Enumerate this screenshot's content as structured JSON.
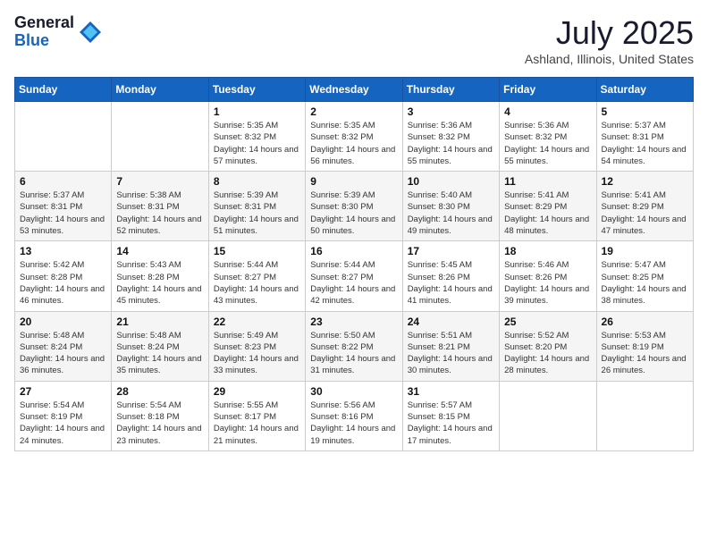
{
  "logo": {
    "general": "General",
    "blue": "Blue"
  },
  "header": {
    "month": "July 2025",
    "location": "Ashland, Illinois, United States"
  },
  "days_of_week": [
    "Sunday",
    "Monday",
    "Tuesday",
    "Wednesday",
    "Thursday",
    "Friday",
    "Saturday"
  ],
  "weeks": [
    [
      {
        "day": "",
        "sunrise": "",
        "sunset": "",
        "daylight": ""
      },
      {
        "day": "",
        "sunrise": "",
        "sunset": "",
        "daylight": ""
      },
      {
        "day": "1",
        "sunrise": "Sunrise: 5:35 AM",
        "sunset": "Sunset: 8:32 PM",
        "daylight": "Daylight: 14 hours and 57 minutes."
      },
      {
        "day": "2",
        "sunrise": "Sunrise: 5:35 AM",
        "sunset": "Sunset: 8:32 PM",
        "daylight": "Daylight: 14 hours and 56 minutes."
      },
      {
        "day": "3",
        "sunrise": "Sunrise: 5:36 AM",
        "sunset": "Sunset: 8:32 PM",
        "daylight": "Daylight: 14 hours and 55 minutes."
      },
      {
        "day": "4",
        "sunrise": "Sunrise: 5:36 AM",
        "sunset": "Sunset: 8:32 PM",
        "daylight": "Daylight: 14 hours and 55 minutes."
      },
      {
        "day": "5",
        "sunrise": "Sunrise: 5:37 AM",
        "sunset": "Sunset: 8:31 PM",
        "daylight": "Daylight: 14 hours and 54 minutes."
      }
    ],
    [
      {
        "day": "6",
        "sunrise": "Sunrise: 5:37 AM",
        "sunset": "Sunset: 8:31 PM",
        "daylight": "Daylight: 14 hours and 53 minutes."
      },
      {
        "day": "7",
        "sunrise": "Sunrise: 5:38 AM",
        "sunset": "Sunset: 8:31 PM",
        "daylight": "Daylight: 14 hours and 52 minutes."
      },
      {
        "day": "8",
        "sunrise": "Sunrise: 5:39 AM",
        "sunset": "Sunset: 8:31 PM",
        "daylight": "Daylight: 14 hours and 51 minutes."
      },
      {
        "day": "9",
        "sunrise": "Sunrise: 5:39 AM",
        "sunset": "Sunset: 8:30 PM",
        "daylight": "Daylight: 14 hours and 50 minutes."
      },
      {
        "day": "10",
        "sunrise": "Sunrise: 5:40 AM",
        "sunset": "Sunset: 8:30 PM",
        "daylight": "Daylight: 14 hours and 49 minutes."
      },
      {
        "day": "11",
        "sunrise": "Sunrise: 5:41 AM",
        "sunset": "Sunset: 8:29 PM",
        "daylight": "Daylight: 14 hours and 48 minutes."
      },
      {
        "day": "12",
        "sunrise": "Sunrise: 5:41 AM",
        "sunset": "Sunset: 8:29 PM",
        "daylight": "Daylight: 14 hours and 47 minutes."
      }
    ],
    [
      {
        "day": "13",
        "sunrise": "Sunrise: 5:42 AM",
        "sunset": "Sunset: 8:28 PM",
        "daylight": "Daylight: 14 hours and 46 minutes."
      },
      {
        "day": "14",
        "sunrise": "Sunrise: 5:43 AM",
        "sunset": "Sunset: 8:28 PM",
        "daylight": "Daylight: 14 hours and 45 minutes."
      },
      {
        "day": "15",
        "sunrise": "Sunrise: 5:44 AM",
        "sunset": "Sunset: 8:27 PM",
        "daylight": "Daylight: 14 hours and 43 minutes."
      },
      {
        "day": "16",
        "sunrise": "Sunrise: 5:44 AM",
        "sunset": "Sunset: 8:27 PM",
        "daylight": "Daylight: 14 hours and 42 minutes."
      },
      {
        "day": "17",
        "sunrise": "Sunrise: 5:45 AM",
        "sunset": "Sunset: 8:26 PM",
        "daylight": "Daylight: 14 hours and 41 minutes."
      },
      {
        "day": "18",
        "sunrise": "Sunrise: 5:46 AM",
        "sunset": "Sunset: 8:26 PM",
        "daylight": "Daylight: 14 hours and 39 minutes."
      },
      {
        "day": "19",
        "sunrise": "Sunrise: 5:47 AM",
        "sunset": "Sunset: 8:25 PM",
        "daylight": "Daylight: 14 hours and 38 minutes."
      }
    ],
    [
      {
        "day": "20",
        "sunrise": "Sunrise: 5:48 AM",
        "sunset": "Sunset: 8:24 PM",
        "daylight": "Daylight: 14 hours and 36 minutes."
      },
      {
        "day": "21",
        "sunrise": "Sunrise: 5:48 AM",
        "sunset": "Sunset: 8:24 PM",
        "daylight": "Daylight: 14 hours and 35 minutes."
      },
      {
        "day": "22",
        "sunrise": "Sunrise: 5:49 AM",
        "sunset": "Sunset: 8:23 PM",
        "daylight": "Daylight: 14 hours and 33 minutes."
      },
      {
        "day": "23",
        "sunrise": "Sunrise: 5:50 AM",
        "sunset": "Sunset: 8:22 PM",
        "daylight": "Daylight: 14 hours and 31 minutes."
      },
      {
        "day": "24",
        "sunrise": "Sunrise: 5:51 AM",
        "sunset": "Sunset: 8:21 PM",
        "daylight": "Daylight: 14 hours and 30 minutes."
      },
      {
        "day": "25",
        "sunrise": "Sunrise: 5:52 AM",
        "sunset": "Sunset: 8:20 PM",
        "daylight": "Daylight: 14 hours and 28 minutes."
      },
      {
        "day": "26",
        "sunrise": "Sunrise: 5:53 AM",
        "sunset": "Sunset: 8:19 PM",
        "daylight": "Daylight: 14 hours and 26 minutes."
      }
    ],
    [
      {
        "day": "27",
        "sunrise": "Sunrise: 5:54 AM",
        "sunset": "Sunset: 8:19 PM",
        "daylight": "Daylight: 14 hours and 24 minutes."
      },
      {
        "day": "28",
        "sunrise": "Sunrise: 5:54 AM",
        "sunset": "Sunset: 8:18 PM",
        "daylight": "Daylight: 14 hours and 23 minutes."
      },
      {
        "day": "29",
        "sunrise": "Sunrise: 5:55 AM",
        "sunset": "Sunset: 8:17 PM",
        "daylight": "Daylight: 14 hours and 21 minutes."
      },
      {
        "day": "30",
        "sunrise": "Sunrise: 5:56 AM",
        "sunset": "Sunset: 8:16 PM",
        "daylight": "Daylight: 14 hours and 19 minutes."
      },
      {
        "day": "31",
        "sunrise": "Sunrise: 5:57 AM",
        "sunset": "Sunset: 8:15 PM",
        "daylight": "Daylight: 14 hours and 17 minutes."
      },
      {
        "day": "",
        "sunrise": "",
        "sunset": "",
        "daylight": ""
      },
      {
        "day": "",
        "sunrise": "",
        "sunset": "",
        "daylight": ""
      }
    ]
  ]
}
